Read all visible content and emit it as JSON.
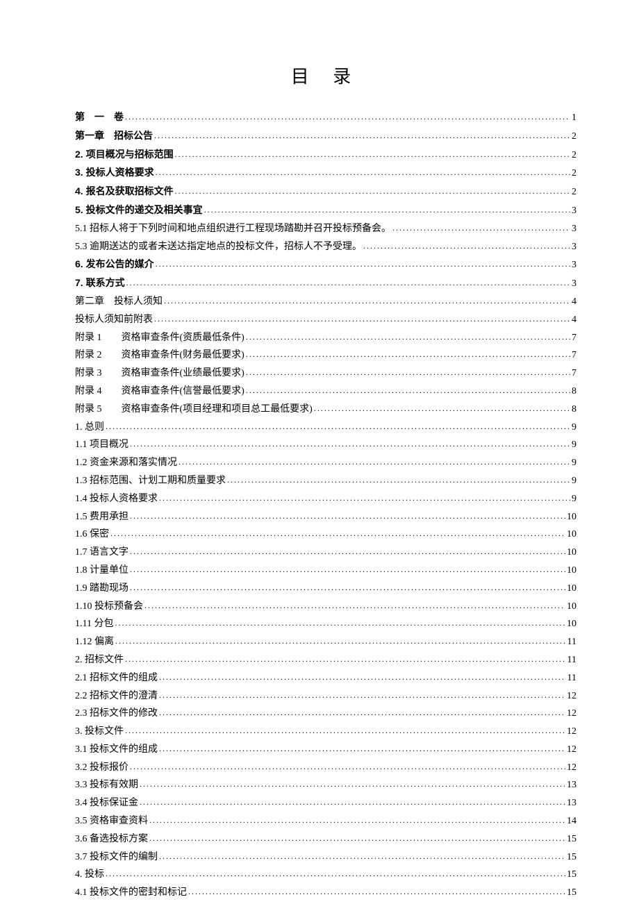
{
  "title": "目 录",
  "entries": [
    {
      "label": "第　一　卷",
      "page": "1",
      "bold": true
    },
    {
      "label": "第一章　招标公告",
      "page": "2",
      "bold": true
    },
    {
      "label": "2. 项目概况与招标范围",
      "page": "2",
      "bold": true
    },
    {
      "label": "3. 投标人资格要求",
      "page": "2",
      "bold": true
    },
    {
      "label": "4. 报名及获取招标文件",
      "page": "2",
      "bold": true
    },
    {
      "label": "5. 投标文件的递交及相关事宜",
      "page": "3",
      "bold": true
    },
    {
      "label": "5.1 招标人将于下列时间和地点组织进行工程现场踏勘并召开投标预备会。",
      "page": "3",
      "bold": false
    },
    {
      "label": "5.3 逾期送达的或者未送达指定地点的投标文件，招标人不予受理。",
      "page": "3",
      "bold": false
    },
    {
      "label": "6. 发布公告的媒介",
      "page": "3",
      "bold": true
    },
    {
      "label": "7. 联系方式",
      "page": "3",
      "bold": true
    },
    {
      "label": "第二章　投标人须知",
      "page": "4",
      "bold": false
    },
    {
      "label": "投标人须知前附表",
      "page": "4",
      "bold": false
    },
    {
      "prefix": "附录 1",
      "label": "资格审查条件(资质最低条件)",
      "page": "7",
      "bold": false,
      "appendix": true
    },
    {
      "prefix": "附录 2",
      "label": "资格审查条件(财务最低要求)",
      "page": "7",
      "bold": false,
      "appendix": true
    },
    {
      "prefix": "附录 3",
      "label": "资格审查条件(业绩最低要求)",
      "page": "7",
      "bold": false,
      "appendix": true
    },
    {
      "prefix": "附录 4",
      "label": "资格审查条件(信誉最低要求)",
      "page": "8",
      "bold": false,
      "appendix": true
    },
    {
      "prefix": "附录 5",
      "label": "资格审查条件(项目经理和项目总工最低要求)",
      "page": "8",
      "bold": false,
      "appendix": true
    },
    {
      "label": "1. 总则",
      "page": "9",
      "bold": false
    },
    {
      "label": "1.1 项目概况",
      "page": "9",
      "bold": false
    },
    {
      "label": "1.2 资金来源和落实情况",
      "page": "9",
      "bold": false
    },
    {
      "label": "1.3 招标范围、计划工期和质量要求",
      "page": "9",
      "bold": false
    },
    {
      "label": "1.4 投标人资格要求",
      "page": "9",
      "bold": false
    },
    {
      "label": "1.5 费用承担",
      "page": "10",
      "bold": false
    },
    {
      "label": "1.6 保密",
      "page": "10",
      "bold": false
    },
    {
      "label": "1.7 语言文字",
      "page": "10",
      "bold": false
    },
    {
      "label": "1.8 计量单位",
      "page": "10",
      "bold": false
    },
    {
      "label": "1.9 踏勘现场",
      "page": "10",
      "bold": false
    },
    {
      "label": "1.10 投标预备会",
      "page": "10",
      "bold": false
    },
    {
      "label": "1.11 分包",
      "page": "10",
      "bold": false
    },
    {
      "label": "1.12 偏离",
      "page": "11",
      "bold": false
    },
    {
      "label": "2. 招标文件",
      "page": "11",
      "bold": false
    },
    {
      "label": "2.1 招标文件的组成",
      "page": "11",
      "bold": false
    },
    {
      "label": "2.2 招标文件的澄清",
      "page": "12",
      "bold": false
    },
    {
      "label": "2.3 招标文件的修改",
      "page": "12",
      "bold": false
    },
    {
      "label": "3. 投标文件",
      "page": "12",
      "bold": false
    },
    {
      "label": "3.1 投标文件的组成",
      "page": "12",
      "bold": false
    },
    {
      "label": "3.2 投标报价",
      "page": "12",
      "bold": false
    },
    {
      "label": "3.3 投标有效期",
      "page": "13",
      "bold": false
    },
    {
      "label": "3.4 投标保证金",
      "page": "13",
      "bold": false
    },
    {
      "label": "3.5 资格审查资料",
      "page": "14",
      "bold": false
    },
    {
      "label": "3.6 备选投标方案",
      "page": "15",
      "bold": false
    },
    {
      "label": "3.7 投标文件的编制",
      "page": "15",
      "bold": false
    },
    {
      "label": "4. 投标",
      "page": "15",
      "bold": false
    },
    {
      "label": "4.1 投标文件的密封和标记",
      "page": "15",
      "bold": false
    }
  ]
}
